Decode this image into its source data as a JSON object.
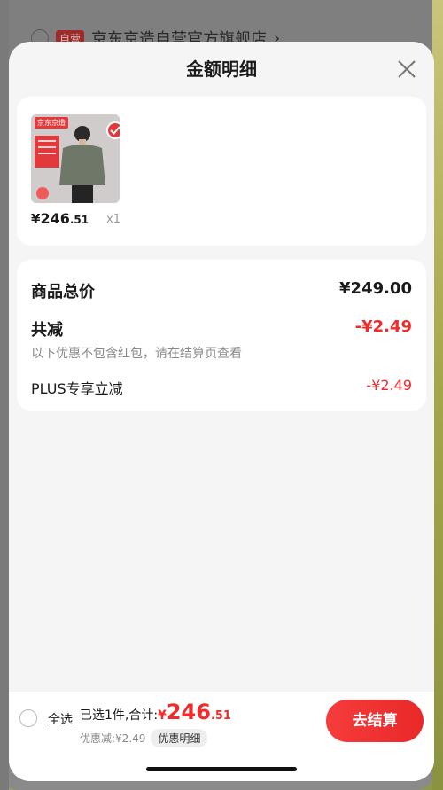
{
  "background": {
    "store_badge": "自营",
    "store_name": "京东京造自营官方旗舰店",
    "chevron": "›"
  },
  "sheet": {
    "title": "金额明细",
    "close_icon": "close-icon"
  },
  "product": {
    "image_tag": "京东京造",
    "price_currency": "¥",
    "price_int": "246",
    "price_dec": ".51",
    "quantity": "x1",
    "selected": true
  },
  "breakdown": {
    "total_label": "商品总价",
    "total_value": "¥249.00",
    "discount_label": "共减",
    "discount_value": "-¥2.49",
    "discount_note": "以下优惠不包含红包，请在结算页查看",
    "plus_label": "PLUS专享立减",
    "plus_value": "-¥2.49"
  },
  "footer": {
    "select_all": "全选",
    "summary_prefix": "已选1件,合计:",
    "total_currency": "¥",
    "total_int": "246",
    "total_dec": ".51",
    "discount_text": "优惠减:¥2.49",
    "discount_detail": "优惠明细",
    "checkout": "去结算"
  },
  "colors": {
    "accent": "#f02b2b",
    "checkout": "#ea2828"
  }
}
